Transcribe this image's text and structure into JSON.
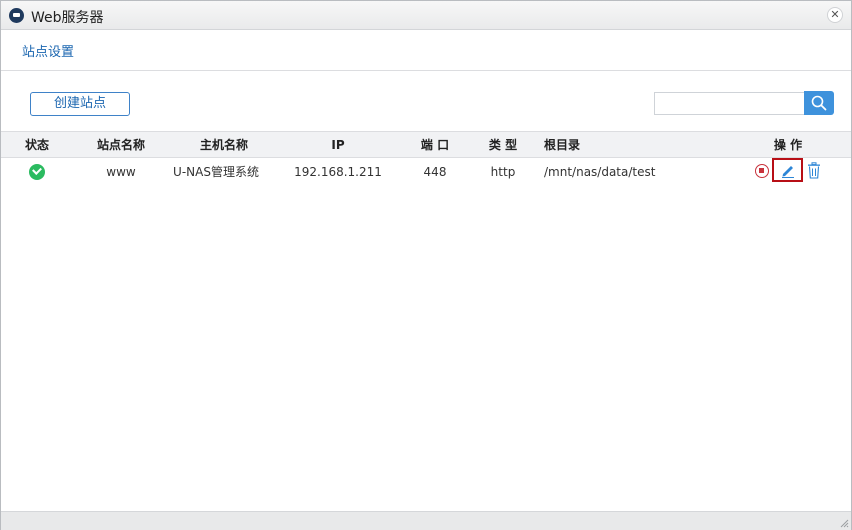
{
  "window": {
    "title": "Web服务器"
  },
  "tabs": {
    "site_settings": "站点设置"
  },
  "toolbar": {
    "create_site_label": "创建站点",
    "search_placeholder": ""
  },
  "table": {
    "headers": {
      "status": "状态",
      "site_name": "站点名称",
      "host_name": "主机名称",
      "ip": "IP",
      "port": "端 口",
      "type": "类 型",
      "root_dir": "根目录",
      "actions": "操 作"
    },
    "rows": [
      {
        "status": "running",
        "site_name": "www",
        "host_name": "U-NAS管理系统",
        "ip": "192.168.1.211",
        "port": "448",
        "type": "http",
        "root_dir": "/mnt/nas/data/test"
      }
    ]
  },
  "colors": {
    "accent": "#1b66b0",
    "search_button": "#3e92dc",
    "status_ok": "#2bbb60",
    "stop": "#c8323c",
    "highlight_border": "#b80f16"
  },
  "icons": [
    "app-icon",
    "close-icon",
    "search-icon",
    "check-circle-icon",
    "stop-icon",
    "edit-pencil-icon",
    "trash-icon",
    "resize-grip-icon"
  ]
}
